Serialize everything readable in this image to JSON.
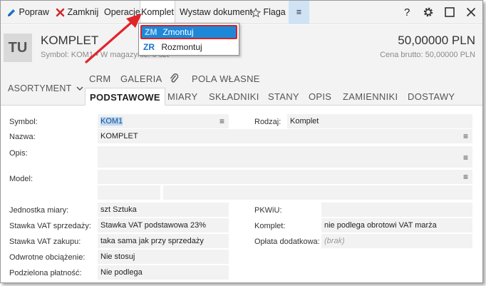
{
  "toolbar": {
    "items": [
      {
        "label": "Popraw",
        "icon": "pencil-icon"
      },
      {
        "label": "Zamknij",
        "icon": "close-icon"
      },
      {
        "label": "Operacje"
      },
      {
        "label": "Komplet"
      },
      {
        "label": "Wystaw dokument"
      },
      {
        "label": "Flaga",
        "icon": "star-icon"
      },
      {
        "label": "≡",
        "icon": "menu-icon"
      }
    ],
    "help": "?"
  },
  "dropdown": {
    "items": [
      {
        "code": "ZM",
        "label": "Zmontuj"
      },
      {
        "code": "ZR",
        "label": "Rozmontuj"
      }
    ]
  },
  "record": {
    "avatar": "TU",
    "title": "KOMPLET",
    "subtitle": "Symbol: KOM1  •  W magazynie: 0 szt",
    "price": "50,00000 PLN",
    "price_sub": "Cena brutto: 50,00000 PLN"
  },
  "tabs": {
    "asortyment": "ASORTYMENT",
    "top_row": [
      "CRM",
      "GALERIA",
      "POLA WŁASNE"
    ],
    "bottom_row": [
      "PODSTAWOWE",
      "MIARY",
      "SKŁADNIKI",
      "STANY",
      "OPIS",
      "ZAMIENNIKI",
      "DOSTAWY"
    ]
  },
  "form": {
    "symbol_label": "Symbol:",
    "symbol_value": "KOM1",
    "rodzaj_label": "Rodzaj:",
    "rodzaj_value": "Komplet",
    "nazwa_label": "Nazwa:",
    "nazwa_value": "KOMPLET",
    "opis_label": "Opis:",
    "model_label": "Model:",
    "jm_label": "Jednostka miary:",
    "jm_value": "szt  Sztuka",
    "pkwiu_label": "PKWiU:",
    "vat_sprz_label": "Stawka VAT sprzedaży:",
    "vat_sprz_value": "Stawka VAT podstawowa 23%",
    "komplet_label": "Komplet:",
    "komplet_value": "nie podlega obrotowi VAT marża",
    "vat_zak_label": "Stawka VAT zakupu:",
    "vat_zak_value": "taka sama jak przy sprzedaży",
    "oplata_label": "Opłata dodatkowa:",
    "oplata_value": "(brak)",
    "odwrotne_label": "Odwrotne obciążenie:",
    "odwrotne_value": "Nie stosuj",
    "podzielona_label": "Podzielona płatność:",
    "podzielona_value": "Nie podlega",
    "ellipsis": "≡"
  },
  "colors": {
    "accent": "#1e88d8",
    "highlight_border": "#d0242a",
    "close_red": "#d0242a"
  }
}
